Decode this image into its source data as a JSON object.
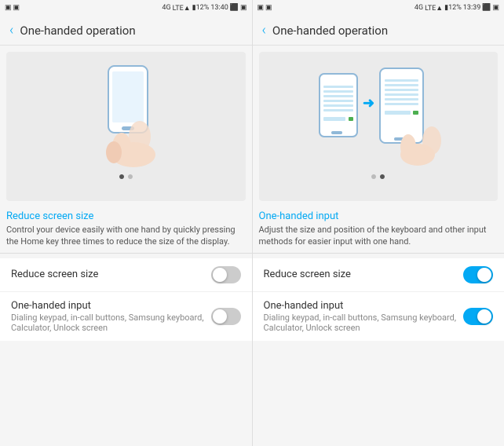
{
  "left_panel": {
    "status": {
      "left": "▣ ▣",
      "network": "4G",
      "lte": "LTE 4",
      "battery": "12%",
      "time": "13:40",
      "icons": "⬛ ▣"
    },
    "header": {
      "back_label": "‹",
      "title": "One-handed operation"
    },
    "carousel": {
      "dots": [
        true,
        false
      ]
    },
    "feature": {
      "title": "Reduce screen size",
      "description": "Control your device easily with one hand by quickly pressing the Home key three times to reduce the size of the display."
    },
    "settings": [
      {
        "label": "Reduce screen size",
        "sublabel": "",
        "toggle": "off"
      },
      {
        "label": "One-handed input",
        "sublabel": "Dialing keypad, in-call buttons, Samsung keyboard, Calculator, Unlock screen",
        "toggle": "off"
      }
    ]
  },
  "right_panel": {
    "status": {
      "left": "▣ ▣",
      "network": "4G",
      "lte": "LTE 4",
      "battery": "12%",
      "time": "13:39",
      "icons": "⬛ ▣"
    },
    "header": {
      "back_label": "‹",
      "title": "One-handed operation"
    },
    "carousel": {
      "dots": [
        false,
        true
      ]
    },
    "feature": {
      "title": "One-handed input",
      "description": "Adjust the size and position of the keyboard and other input methods for easier input with one hand."
    },
    "settings": [
      {
        "label": "Reduce screen size",
        "sublabel": "",
        "toggle": "on"
      },
      {
        "label": "One-handed input",
        "sublabel": "Dialing keypad, in-call buttons, Samsung keyboard, Calculator, Unlock screen",
        "toggle": "on"
      }
    ]
  },
  "accent_color": "#03a9f4"
}
